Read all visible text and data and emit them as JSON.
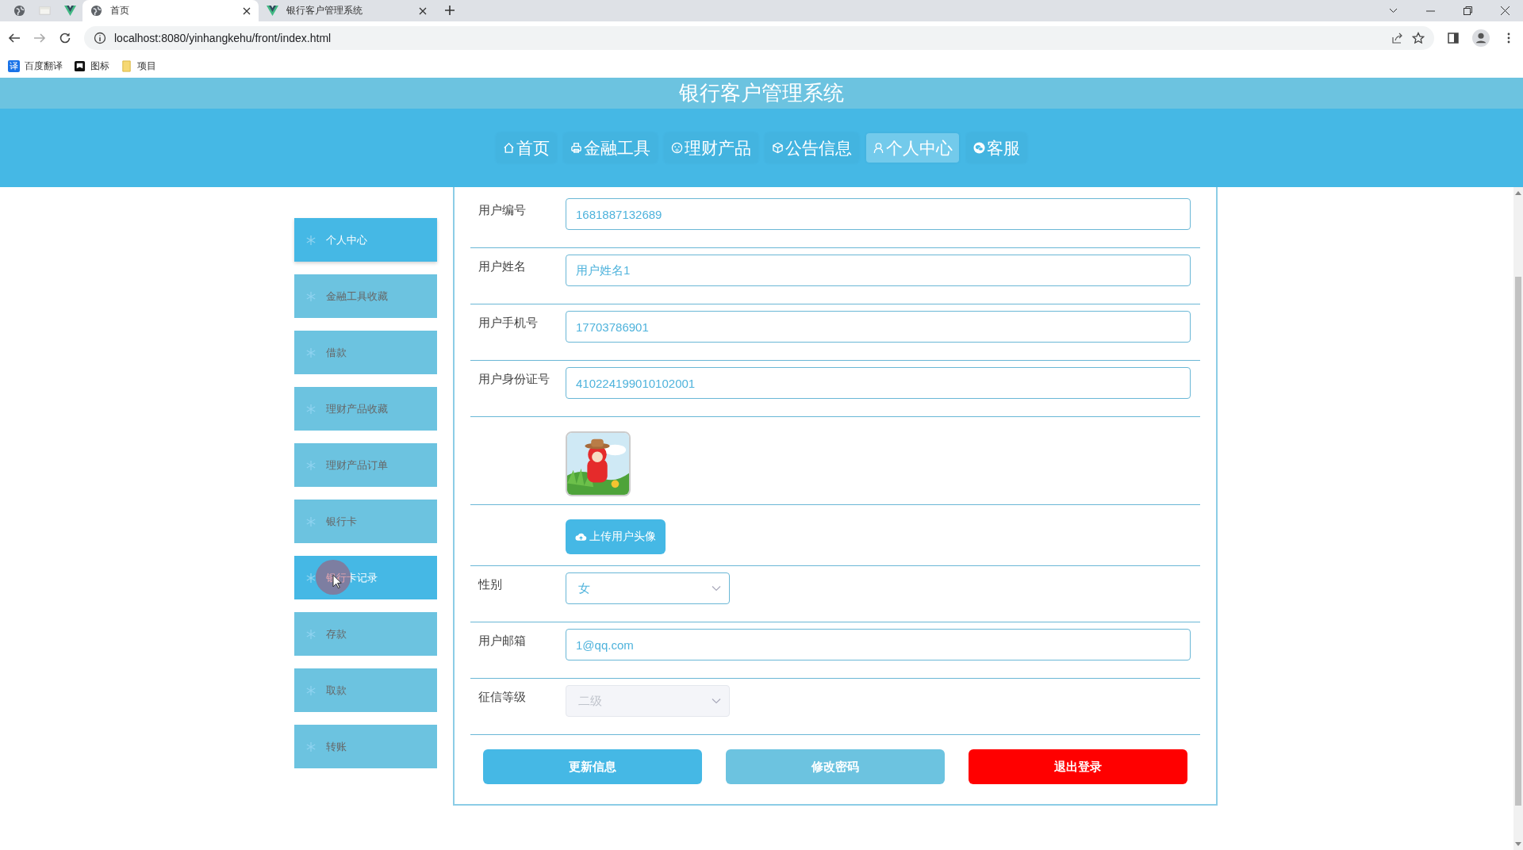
{
  "browser": {
    "pinned_tabs": [
      {
        "kind": "globe"
      },
      {
        "kind": "page"
      },
      {
        "kind": "vue"
      }
    ],
    "tabs": [
      {
        "kind": "globe",
        "title": "首页",
        "selected": true
      },
      {
        "kind": "vue",
        "title": "银行客户管理系统",
        "selected": false
      }
    ],
    "url": "localhost:8080/yinhangkehu/front/index.html",
    "bookmarks": [
      {
        "kind": "translate",
        "badge": "译",
        "label": "百度翻译"
      },
      {
        "kind": "flag",
        "label": "图标"
      },
      {
        "kind": "folder",
        "label": "项目"
      }
    ]
  },
  "site_title": "银行客户管理系统",
  "nav": [
    {
      "kind": "home",
      "label": "首页",
      "selected": false
    },
    {
      "kind": "printer",
      "label": "金融工具",
      "selected": false
    },
    {
      "kind": "face",
      "label": "理财产品",
      "selected": false
    },
    {
      "kind": "cube",
      "label": "公告信息",
      "selected": false
    },
    {
      "kind": "person",
      "label": "个人中心",
      "selected": true
    },
    {
      "kind": "chat",
      "label": "客服",
      "selected": false
    }
  ],
  "sidebar": [
    {
      "label": "个人中心",
      "selected": true,
      "hovered": false
    },
    {
      "label": "金融工具收藏",
      "selected": false,
      "hovered": false
    },
    {
      "label": "借款",
      "selected": false,
      "hovered": false
    },
    {
      "label": "理财产品收藏",
      "selected": false,
      "hovered": false
    },
    {
      "label": "理财产品订单",
      "selected": false,
      "hovered": false
    },
    {
      "label": "银行卡",
      "selected": false,
      "hovered": false
    },
    {
      "label": "银行卡记录",
      "selected": false,
      "hovered": true
    },
    {
      "label": "存款",
      "selected": false,
      "hovered": false
    },
    {
      "label": "取款",
      "selected": false,
      "hovered": false
    },
    {
      "label": "转账",
      "selected": false,
      "hovered": false
    }
  ],
  "form": [
    {
      "kind": "input",
      "label": "用户编号",
      "value": "1681887132689"
    },
    {
      "kind": "input",
      "label": "用户姓名",
      "value": "用户姓名1"
    },
    {
      "kind": "input",
      "label": "用户手机号",
      "value": "17703786901"
    },
    {
      "kind": "input",
      "label": "用户身份证号",
      "value": "410224199010102001"
    },
    {
      "kind": "picture"
    },
    {
      "kind": "upload",
      "button": "上传用户头像"
    },
    {
      "kind": "select",
      "label": "性别",
      "value": "女",
      "disabled": false
    },
    {
      "kind": "input",
      "label": "用户邮箱",
      "value": "1@qq.com"
    },
    {
      "kind": "select",
      "label": "征信等级",
      "value": "二级",
      "disabled": true
    }
  ],
  "buttons": [
    {
      "kind": "primary",
      "label": "更新信息"
    },
    {
      "kind": "secondary",
      "label": "修改密码"
    },
    {
      "kind": "danger",
      "label": "退出登录"
    }
  ]
}
